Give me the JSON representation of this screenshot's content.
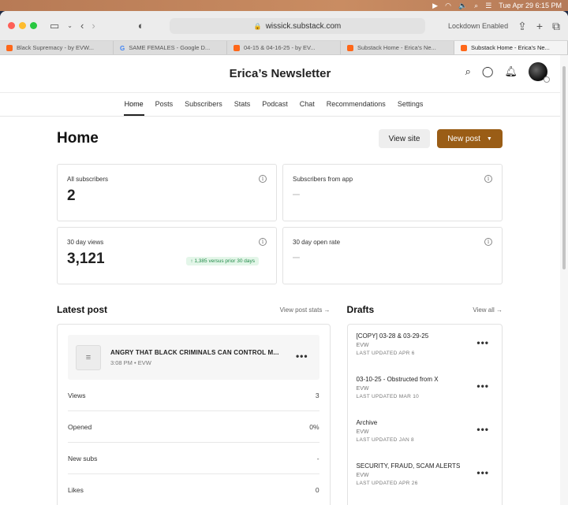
{
  "menubar": {
    "date_time": "Tue Apr 29  6:15 PM"
  },
  "browser": {
    "url": "wissick.substack.com",
    "lockdown": "Lockdown Enabled",
    "tabs": [
      {
        "label": "Black Supremacy - by EVW...",
        "favicon": "substack"
      },
      {
        "label": "SAME FEMALES - Google D...",
        "favicon": "google"
      },
      {
        "label": "04-15 & 04-16-25 - by EV...",
        "favicon": "substack"
      },
      {
        "label": "Substack Home - Erica's Ne...",
        "favicon": "substack"
      },
      {
        "label": "Substack Home - Erica's Ne...",
        "favicon": "substack",
        "active": true
      }
    ]
  },
  "site": {
    "title": "Erica’s Newsletter"
  },
  "nav": {
    "tabs": [
      "Home",
      "Posts",
      "Subscribers",
      "Stats",
      "Podcast",
      "Chat",
      "Recommendations",
      "Settings"
    ],
    "active": "Home"
  },
  "home": {
    "title": "Home",
    "view_site": "View site",
    "new_post": "New post"
  },
  "stats": {
    "all_subscribers": {
      "label": "All subscribers",
      "value": "2"
    },
    "subscribers_from_app": {
      "label": "Subscribers from app",
      "value": "–"
    },
    "views_30": {
      "label": "30 day views",
      "value": "3,121",
      "badge": "1,385 versus prior 30 days"
    },
    "open_rate_30": {
      "label": "30 day open rate",
      "value": "–"
    }
  },
  "latest_post": {
    "heading": "Latest post",
    "link": "View post stats",
    "title": "ANGRY THAT BLACK CRIMINALS CAN CONTROL M...",
    "meta": "3:08 PM • EVW",
    "rows": [
      {
        "label": "Views",
        "value": "3"
      },
      {
        "label": "Opened",
        "value": "0%"
      },
      {
        "label": "New subs",
        "value": "-"
      },
      {
        "label": "Likes",
        "value": "0"
      }
    ]
  },
  "drafts": {
    "heading": "Drafts",
    "link": "View all",
    "items": [
      {
        "title": "[COPY] 03-28 & 03-29-25",
        "author": "EVW",
        "updated": "LAST UPDATED APR 6"
      },
      {
        "title": "03-10-25 - Obstructed from X",
        "author": "EVW",
        "updated": "LAST UPDATED MAR 10"
      },
      {
        "title": "Archive",
        "author": "EVW",
        "updated": "LAST UPDATED JAN 8"
      },
      {
        "title": "SECURITY, FRAUD, SCAM ALERTS",
        "author": "EVW",
        "updated": "LAST UPDATED APR 26"
      }
    ]
  },
  "colors": {
    "brand_button": "#9a5d16",
    "substack_orange": "#ff6719",
    "positive_badge": "#1f8a47"
  }
}
